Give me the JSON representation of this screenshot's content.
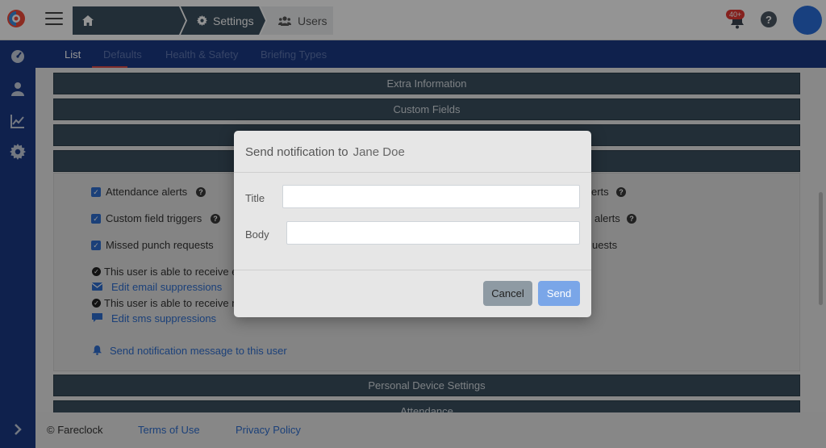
{
  "header": {
    "breadcrumb": {
      "settings": "Settings",
      "users": "Users"
    },
    "notification_badge": "40+"
  },
  "tabs": [
    "List",
    "Defaults",
    "Health & Safety",
    "Briefing Types"
  ],
  "sections": {
    "extra_information": "Extra Information",
    "custom_fields": "Custom Fields",
    "personal_device_settings": "Personal Device Settings",
    "attendance": "Attendance"
  },
  "alerts": {
    "attendance_alerts": "Attendance alerts",
    "custom_field_triggers": "Custom field triggers",
    "missed_punch_requests": "Missed punch requests",
    "right_col_1": "erts",
    "right_col_2": "alerts",
    "right_col_3": "uests"
  },
  "status": {
    "email_status": "This user is able to receive e",
    "edit_email": "Edit email suppressions",
    "sms_status": "This user is able to receive n",
    "edit_sms": "Edit sms suppressions",
    "send_notification_link": "Send notification message to this user"
  },
  "footer": {
    "copyright": "© Fareclock",
    "terms": "Terms of Use",
    "privacy": "Privacy Policy"
  },
  "modal": {
    "title": "Send notification to",
    "recipient": "Jane Doe",
    "title_label": "Title",
    "title_value": "",
    "body_label": "Body",
    "body_value": "",
    "cancel_label": "Cancel",
    "send_label": "Send"
  },
  "colors": {
    "navy": "#1a3a86",
    "section_bar": "#3c5060",
    "link": "#2f6fd1",
    "badge": "#e53935",
    "avatar": "#2a6edb"
  }
}
